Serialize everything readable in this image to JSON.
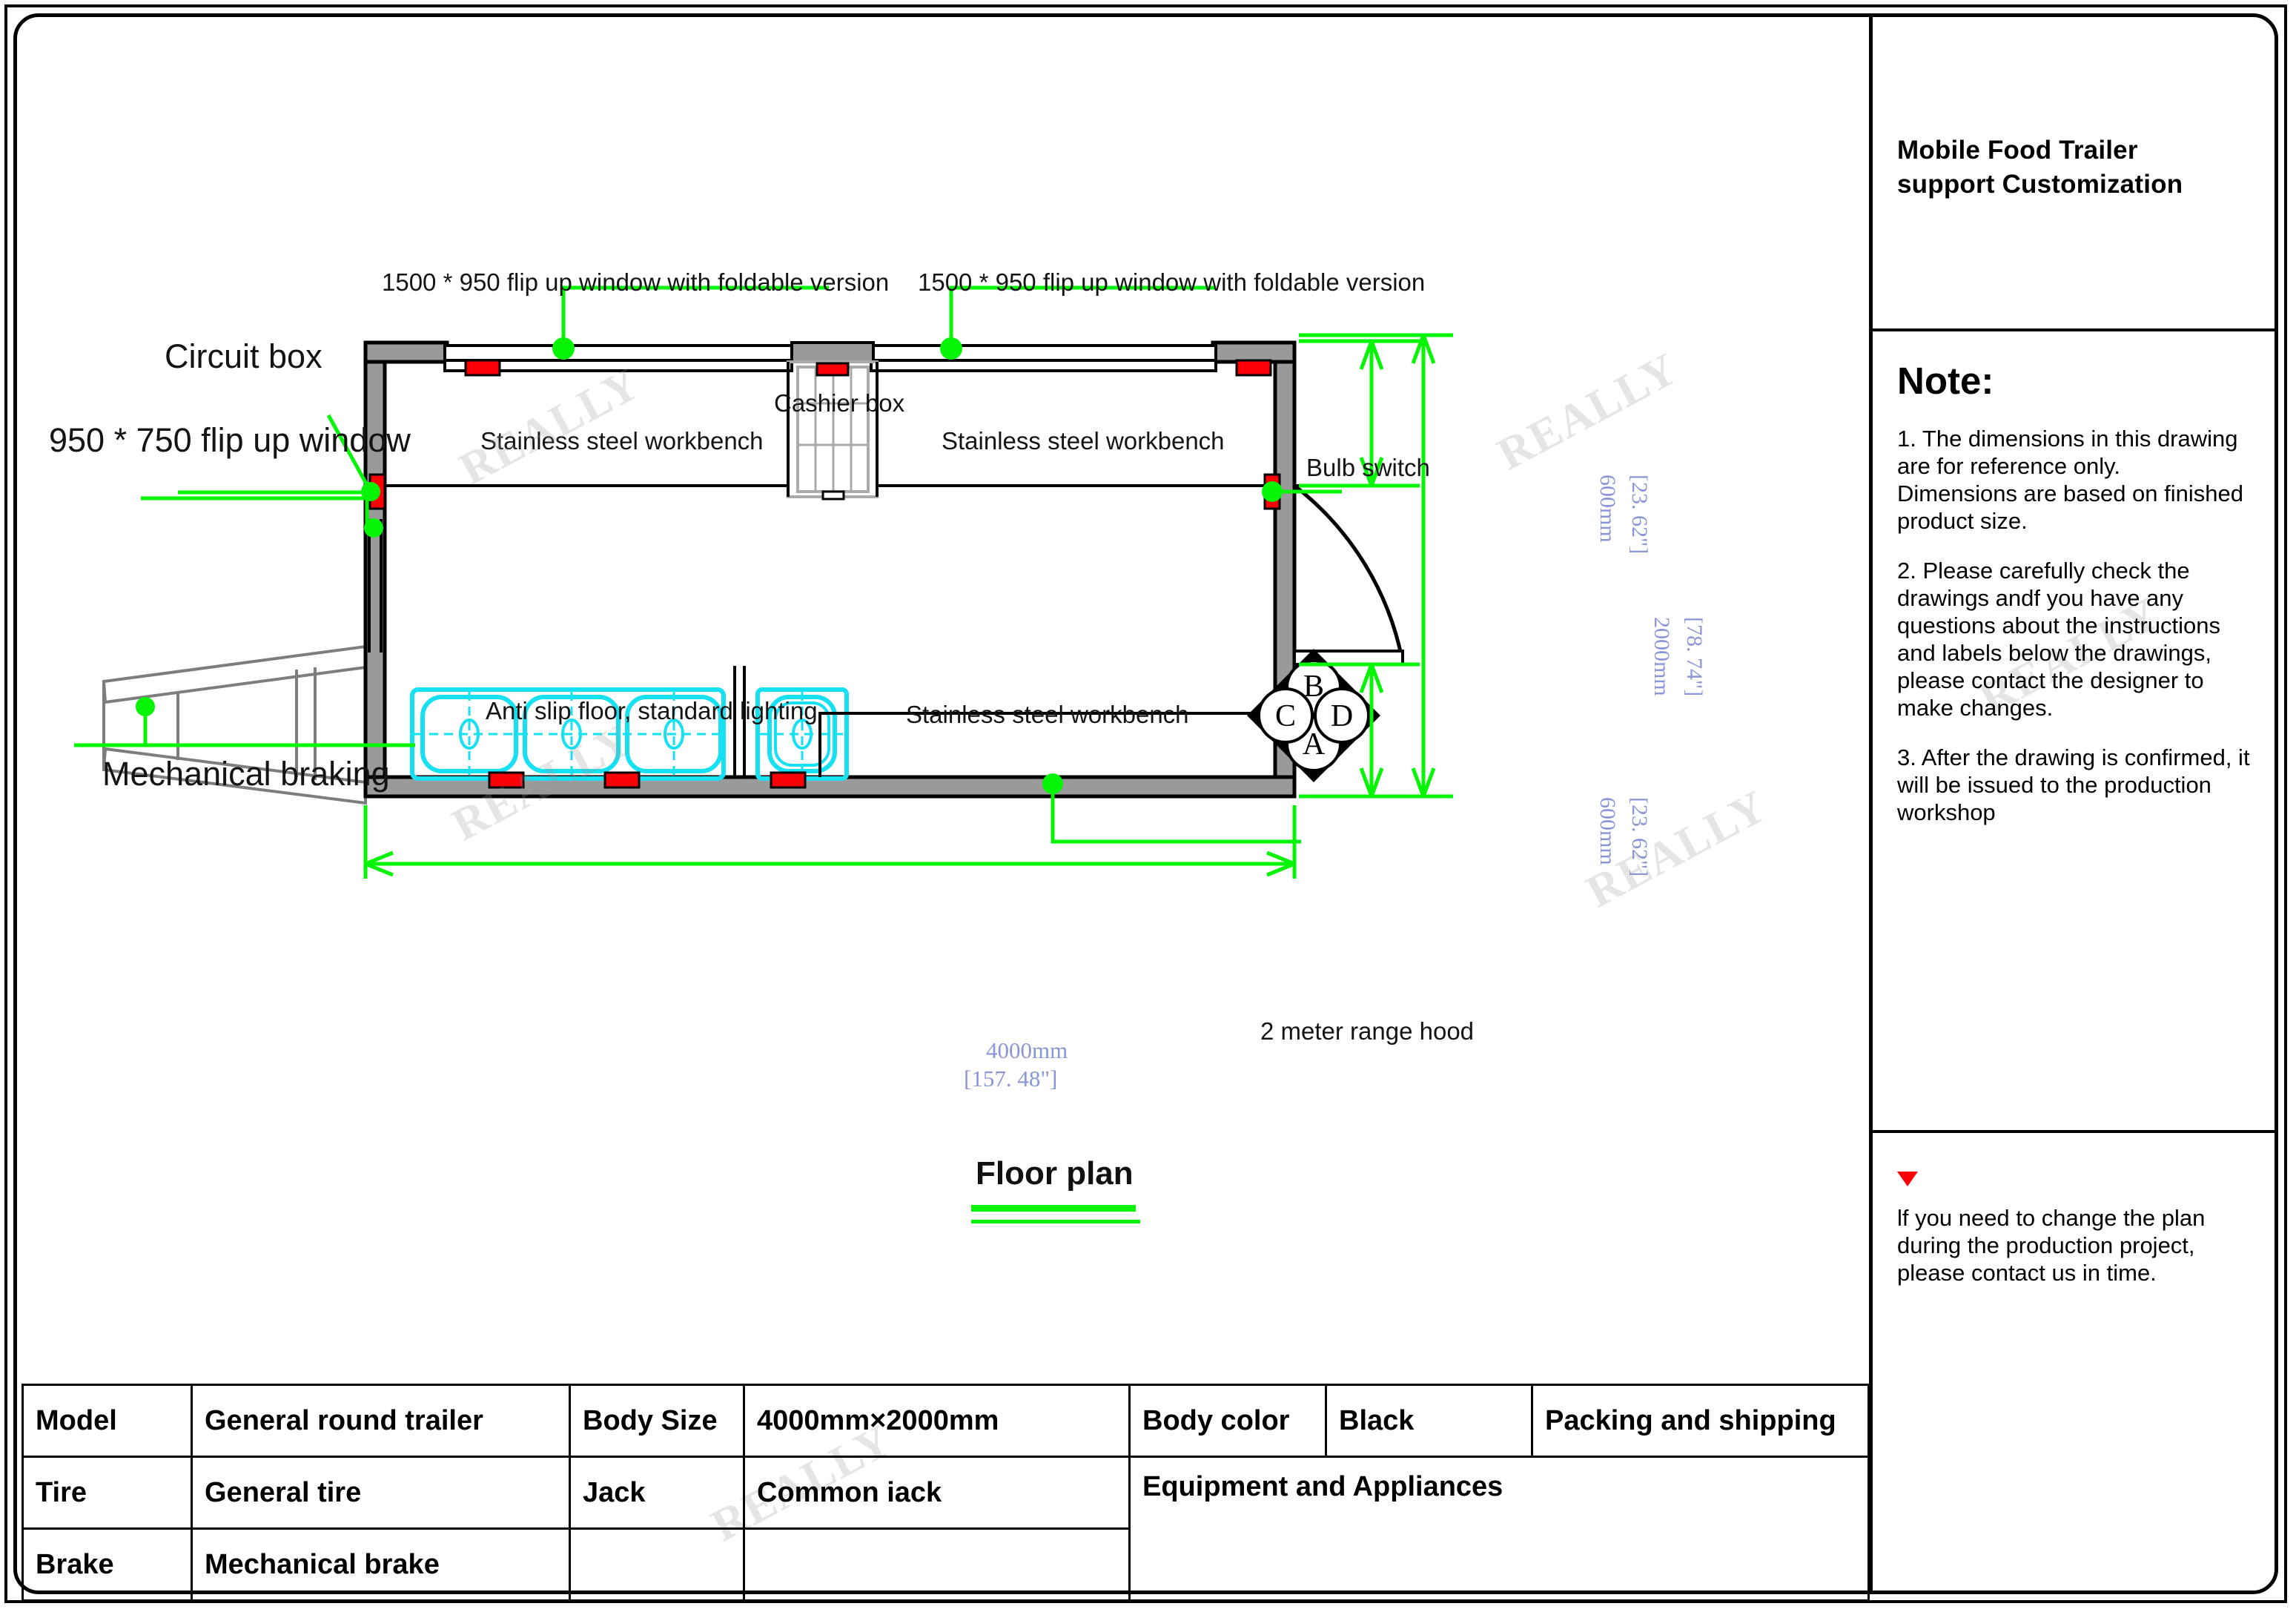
{
  "sheet": {
    "title_block": {
      "line1": "Mobile Food Trailer",
      "line2": "support Customization"
    },
    "note": {
      "heading": "Note:",
      "items": [
        "1. The dimensions in this drawing are for reference only.\nDimensions are based on finished product size.",
        "2. Please carefully check the drawings andf you have any questions about the instructions and labels below the drawings, please contact the designer to make changes.",
        "3. After the drawing is confirmed, it will be issued to the production workshop"
      ]
    },
    "footer": {
      "marker_icon": "red-triangle-down-icon",
      "text": "lf you need to change the plan during the production project, please contact us in time."
    }
  },
  "drawing": {
    "title": "Floor plan",
    "callouts": {
      "circuit_box": "Circuit box",
      "window_950_750": "950 * 750 flip up window",
      "mechanical_braking": "Mechanical braking",
      "window_1500_950_left": "1500 * 950 flip up window with foldable version",
      "window_1500_950_right": "1500 * 950 flip up window with foldable version",
      "cashier_box": "Cashier box",
      "workbench_top_left": "Stainless steel workbench",
      "workbench_top_right": "Stainless steel workbench",
      "workbench_bottom": "Stainless steel workbench",
      "floor": "Anti slip floor, standard lighting",
      "bulb_switch": "Bulb switch",
      "range_hood": "2 meter range hood"
    },
    "compass": {
      "north": "B",
      "south": "A",
      "west": "C",
      "east": "D"
    },
    "dimensions": {
      "length_mm": "4000mm",
      "length_in": "[157. 48\"]",
      "door_top_mm": "600mm",
      "door_top_in": "[23. 62\"]",
      "width_mm": "2000mm",
      "width_in": "[78. 74\"]",
      "door_bottom_mm": "600mm",
      "door_bottom_in": "[23. 62\"]"
    },
    "colors": {
      "callout_green": "#06f406",
      "dimension_blue": "#8a95d6",
      "sink_cyan": "#16e1f2",
      "marker_red": "#fb0007",
      "wall_gray": "#9a9a9a"
    }
  },
  "spec_table": {
    "rows": [
      [
        {
          "text": "Model"
        },
        {
          "text": "General round trailer"
        },
        {
          "text": "Body Size"
        },
        {
          "text": "4000mm×2000mm"
        },
        {
          "text": "Body color"
        },
        {
          "text": "Black"
        },
        {
          "text": "Packing and shipping"
        }
      ],
      [
        {
          "text": "Tire"
        },
        {
          "text": "General tire"
        },
        {
          "text": "Jack"
        },
        {
          "text": "Common iack"
        },
        {
          "text": "Equipment and Appliances"
        }
      ],
      [
        {
          "text": "Brake"
        },
        {
          "text": "Mechanical brake"
        },
        {
          "text": ""
        },
        {
          "text": ""
        }
      ]
    ]
  },
  "watermark": {
    "text": "REALLY"
  }
}
